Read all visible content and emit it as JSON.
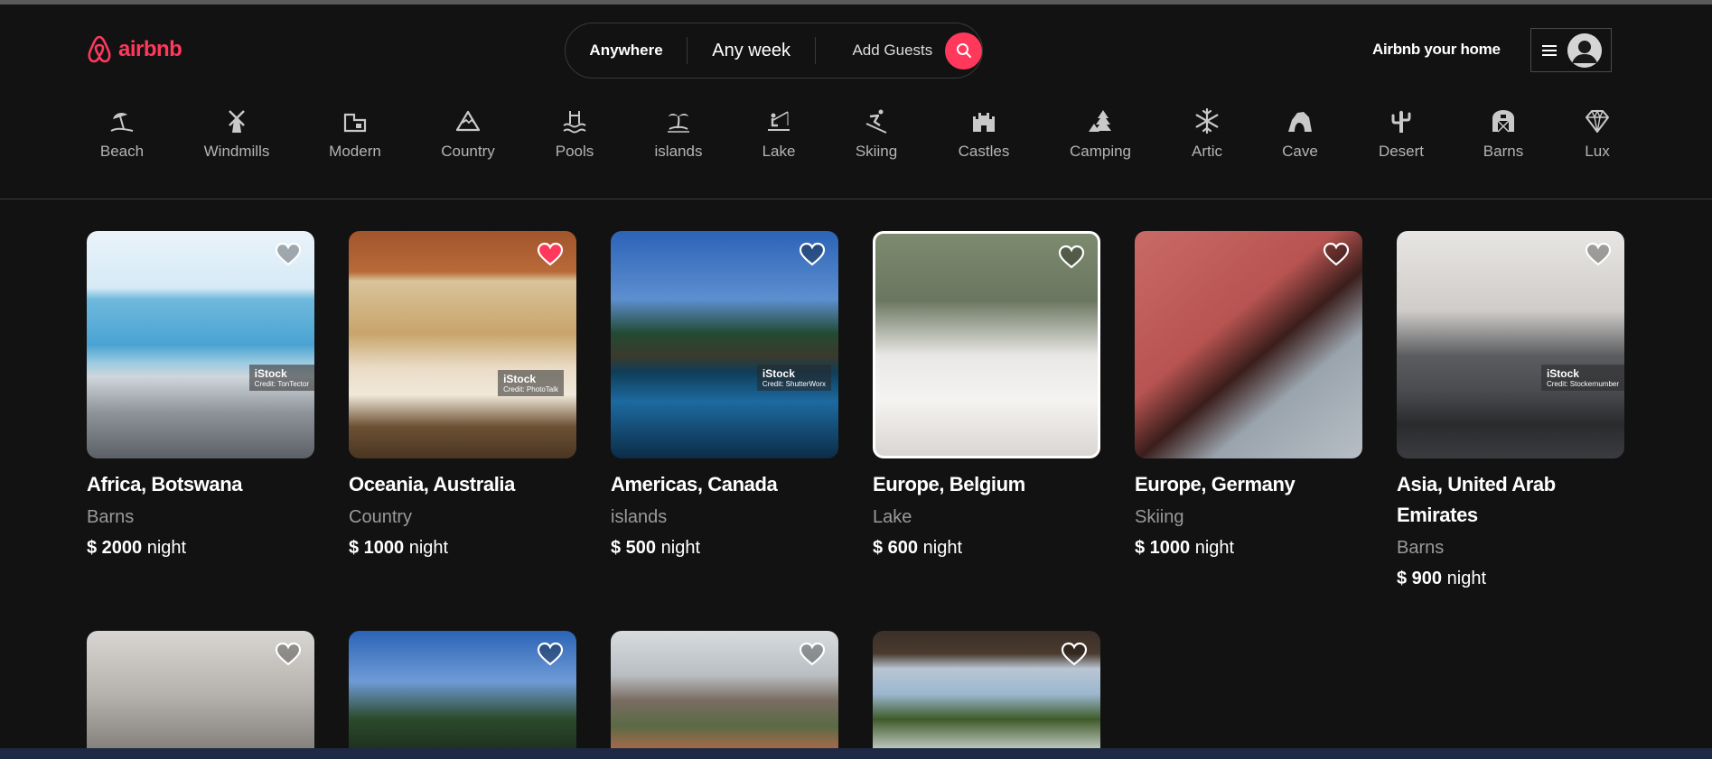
{
  "brand": {
    "name": "airbnb",
    "color": "#ff385c"
  },
  "search": {
    "anywhere": "Anywhere",
    "any_week": "Any week",
    "add_guests": "Add Guests",
    "icon": "search-icon"
  },
  "header": {
    "host_link": "Airbnb your home",
    "menu_icon": "hamburger-icon",
    "avatar_icon": "user-avatar-icon"
  },
  "categories": [
    {
      "label": "Beach",
      "icon": "beach-umbrella-icon"
    },
    {
      "label": "Windmills",
      "icon": "windmill-icon"
    },
    {
      "label": "Modern",
      "icon": "modern-building-icon"
    },
    {
      "label": "Country",
      "icon": "mountain-icon"
    },
    {
      "label": "Pools",
      "icon": "pool-icon"
    },
    {
      "label": "islands",
      "icon": "palm-island-icon"
    },
    {
      "label": "Lake",
      "icon": "fishing-lake-icon"
    },
    {
      "label": "Skiing",
      "icon": "skier-icon"
    },
    {
      "label": "Castles",
      "icon": "castle-icon"
    },
    {
      "label": "Camping",
      "icon": "tent-tree-icon"
    },
    {
      "label": "Artic",
      "icon": "snowflake-icon"
    },
    {
      "label": "Cave",
      "icon": "cave-icon"
    },
    {
      "label": "Desert",
      "icon": "cactus-icon"
    },
    {
      "label": "Barns",
      "icon": "barn-icon"
    },
    {
      "label": "Lux",
      "icon": "diamond-icon"
    }
  ],
  "listings": [
    {
      "title": "Africa, Botswana",
      "category": "Barns",
      "price_amount": "$ 2000",
      "price_unit": "night",
      "favorited": false,
      "stock": {
        "brand": "iStock",
        "credit": "Credit: TonTector"
      }
    },
    {
      "title": "Oceania, Australia",
      "category": "Country",
      "price_amount": "$ 1000",
      "price_unit": "night",
      "favorited": true,
      "stock": {
        "brand": "iStock",
        "credit": "Credit: PhotoTalk"
      }
    },
    {
      "title": "Americas, Canada",
      "category": "islands",
      "price_amount": "$ 500",
      "price_unit": "night",
      "favorited": false,
      "stock": {
        "brand": "iStock",
        "credit": "Credit: ShutterWorx"
      }
    },
    {
      "title": "Europe, Belgium",
      "category": "Lake",
      "price_amount": "$ 600",
      "price_unit": "night",
      "favorited": false,
      "stock": null
    },
    {
      "title": "Europe, Germany",
      "category": "Skiing",
      "price_amount": "$ 1000",
      "price_unit": "night",
      "favorited": false,
      "stock": null
    },
    {
      "title": "Asia, United Arab Emirates",
      "category": "Barns",
      "price_amount": "$ 900",
      "price_unit": "night",
      "favorited": false,
      "stock": {
        "brand": "iStock",
        "credit": "Credit: Stockernumber"
      }
    }
  ],
  "listings_row2": [
    {
      "favorited": false
    },
    {
      "favorited": false
    },
    {
      "favorited": false
    },
    {
      "favorited": false
    }
  ],
  "colors": {
    "background": "#121212",
    "heart_active": "#ff385c",
    "muted_text": "#9a9a9a"
  }
}
